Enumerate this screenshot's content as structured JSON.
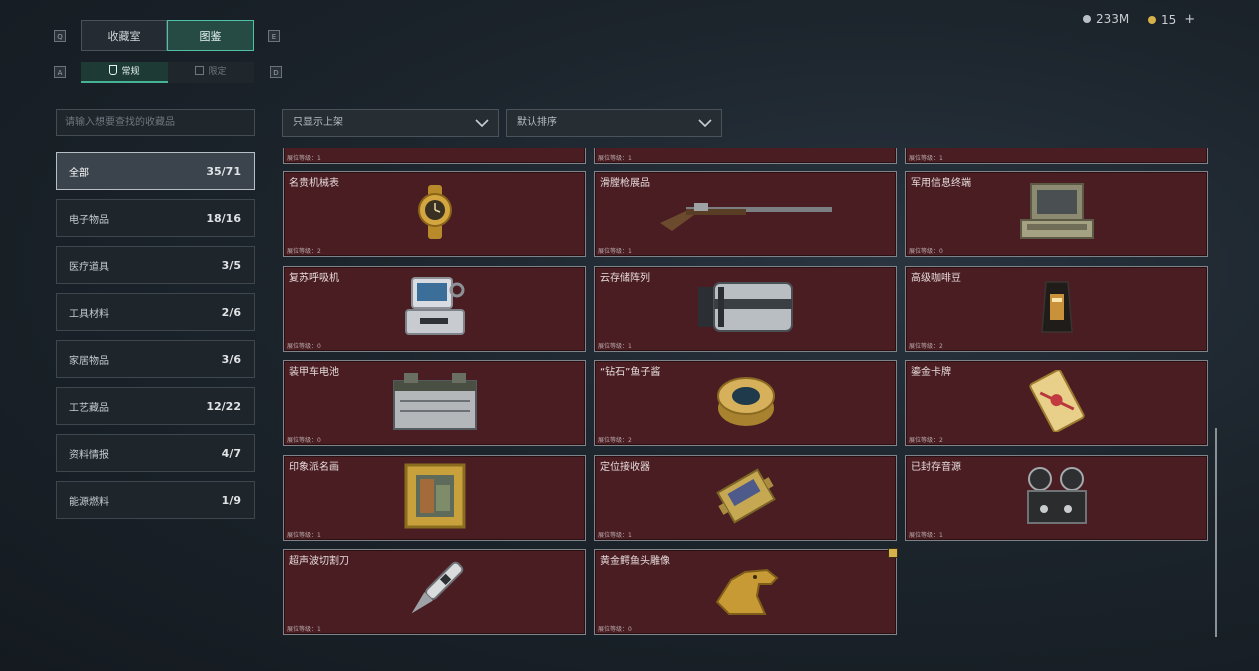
{
  "keys": {
    "q": "Q",
    "e": "E",
    "a": "A",
    "d": "D"
  },
  "tabs": {
    "collection_room": "收藏室",
    "catalog": "图鉴"
  },
  "subtabs": {
    "normal": "常规",
    "limited": "限定"
  },
  "currency": {
    "money": "233M",
    "coins": "15",
    "add": "+"
  },
  "search": {
    "placeholder": "请输入想要查找的收藏品"
  },
  "categories": [
    {
      "label": "全部",
      "count": "35/71",
      "active": true
    },
    {
      "label": "电子物品",
      "count": "18/16"
    },
    {
      "label": "医疗道具",
      "count": "3/5"
    },
    {
      "label": "工具材料",
      "count": "2/6"
    },
    {
      "label": "家居物品",
      "count": "3/6"
    },
    {
      "label": "工艺藏品",
      "count": "12/22"
    },
    {
      "label": "资料情报",
      "count": "4/7"
    },
    {
      "label": "能源燃料",
      "count": "1/9"
    }
  ],
  "filters": {
    "shelf": "只显示上架",
    "sort": "默认排序"
  },
  "partial_row": {
    "levels": [
      "展位等级：1",
      "展位等级：1",
      "展位等级：1"
    ]
  },
  "items": [
    {
      "name": "名贵机械表",
      "level": "展位等级：2",
      "icon": "watch-icon"
    },
    {
      "name": "滑膛枪展品",
      "level": "展位等级：1",
      "icon": "musket-icon"
    },
    {
      "name": "军用信息终端",
      "level": "展位等级：0",
      "icon": "terminal-icon"
    },
    {
      "name": "复苏呼吸机",
      "level": "展位等级：0",
      "icon": "ventilator-icon"
    },
    {
      "name": "云存储阵列",
      "level": "展位等级：1",
      "icon": "storage-array-icon"
    },
    {
      "name": "高级咖啡豆",
      "level": "展位等级：2",
      "icon": "coffee-bag-icon"
    },
    {
      "name": "装甲车电池",
      "level": "展位等级：0",
      "icon": "battery-icon"
    },
    {
      "name": "“钻石”鱼子酱",
      "level": "展位等级：2",
      "icon": "caviar-tin-icon"
    },
    {
      "name": "鎏金卡牌",
      "level": "展位等级：2",
      "icon": "gold-card-icon"
    },
    {
      "name": "印象派名画",
      "level": "展位等级：1",
      "icon": "painting-icon"
    },
    {
      "name": "定位接收器",
      "level": "展位等级：1",
      "icon": "receiver-icon"
    },
    {
      "name": "已封存音源",
      "level": "展位等级：1",
      "icon": "tape-recorder-icon"
    },
    {
      "name": "超声波切割刀",
      "level": "展位等级：1",
      "icon": "cutter-knife-icon"
    },
    {
      "name": "黄金鳄鱼头雕像",
      "level": "展位等级：0",
      "icon": "gold-croc-statue-icon"
    }
  ],
  "colors": {
    "accent": "#4fc1a6",
    "card_bg": "#4a1d22",
    "gold": "#d6b24a"
  }
}
